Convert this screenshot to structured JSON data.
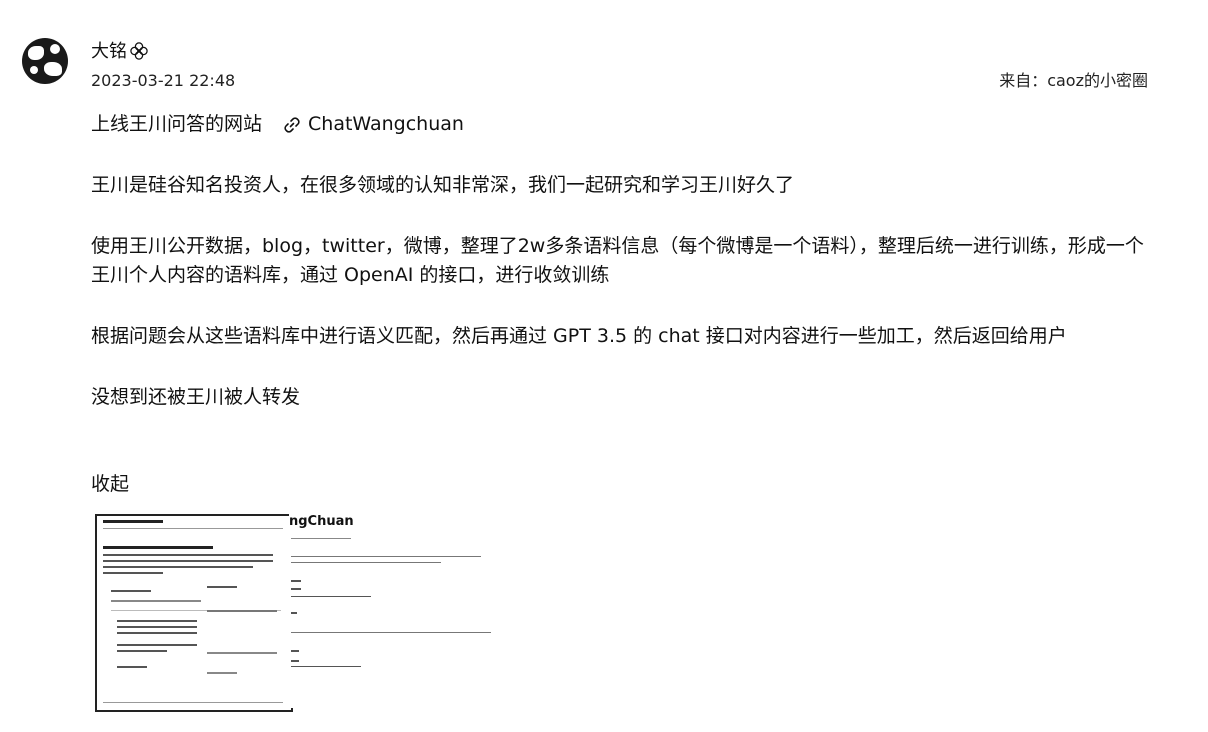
{
  "post": {
    "author": "大铭",
    "timestamp": "2023-03-21 22:48",
    "source": "来自：caoz的小密圈"
  },
  "content": {
    "title_line": "上线王川问答的网站",
    "link_label": "ChatWangchuan",
    "paragraphs": [
      "王川是硅谷知名投资人，在很多领域的认知非常深，我们一起研究和学习王川好久了",
      "使用王川公开数据，blog，twitter，微博，整理了2w多条语料信息（每个微博是一个语料），整理后统一进行训练，形成一个王川个人内容的语料库，通过 OpenAI 的接口，进行收敛训练",
      "根据问题会从这些语料库中进行语义匹配，然后再通过 GPT 3.5 的 chat 接口对内容进行一些加工，然后返回给用户",
      "没想到还被王川被人转发"
    ],
    "collapse_label": "收起"
  },
  "thumbnail": {
    "right_title": "ngChuan"
  }
}
